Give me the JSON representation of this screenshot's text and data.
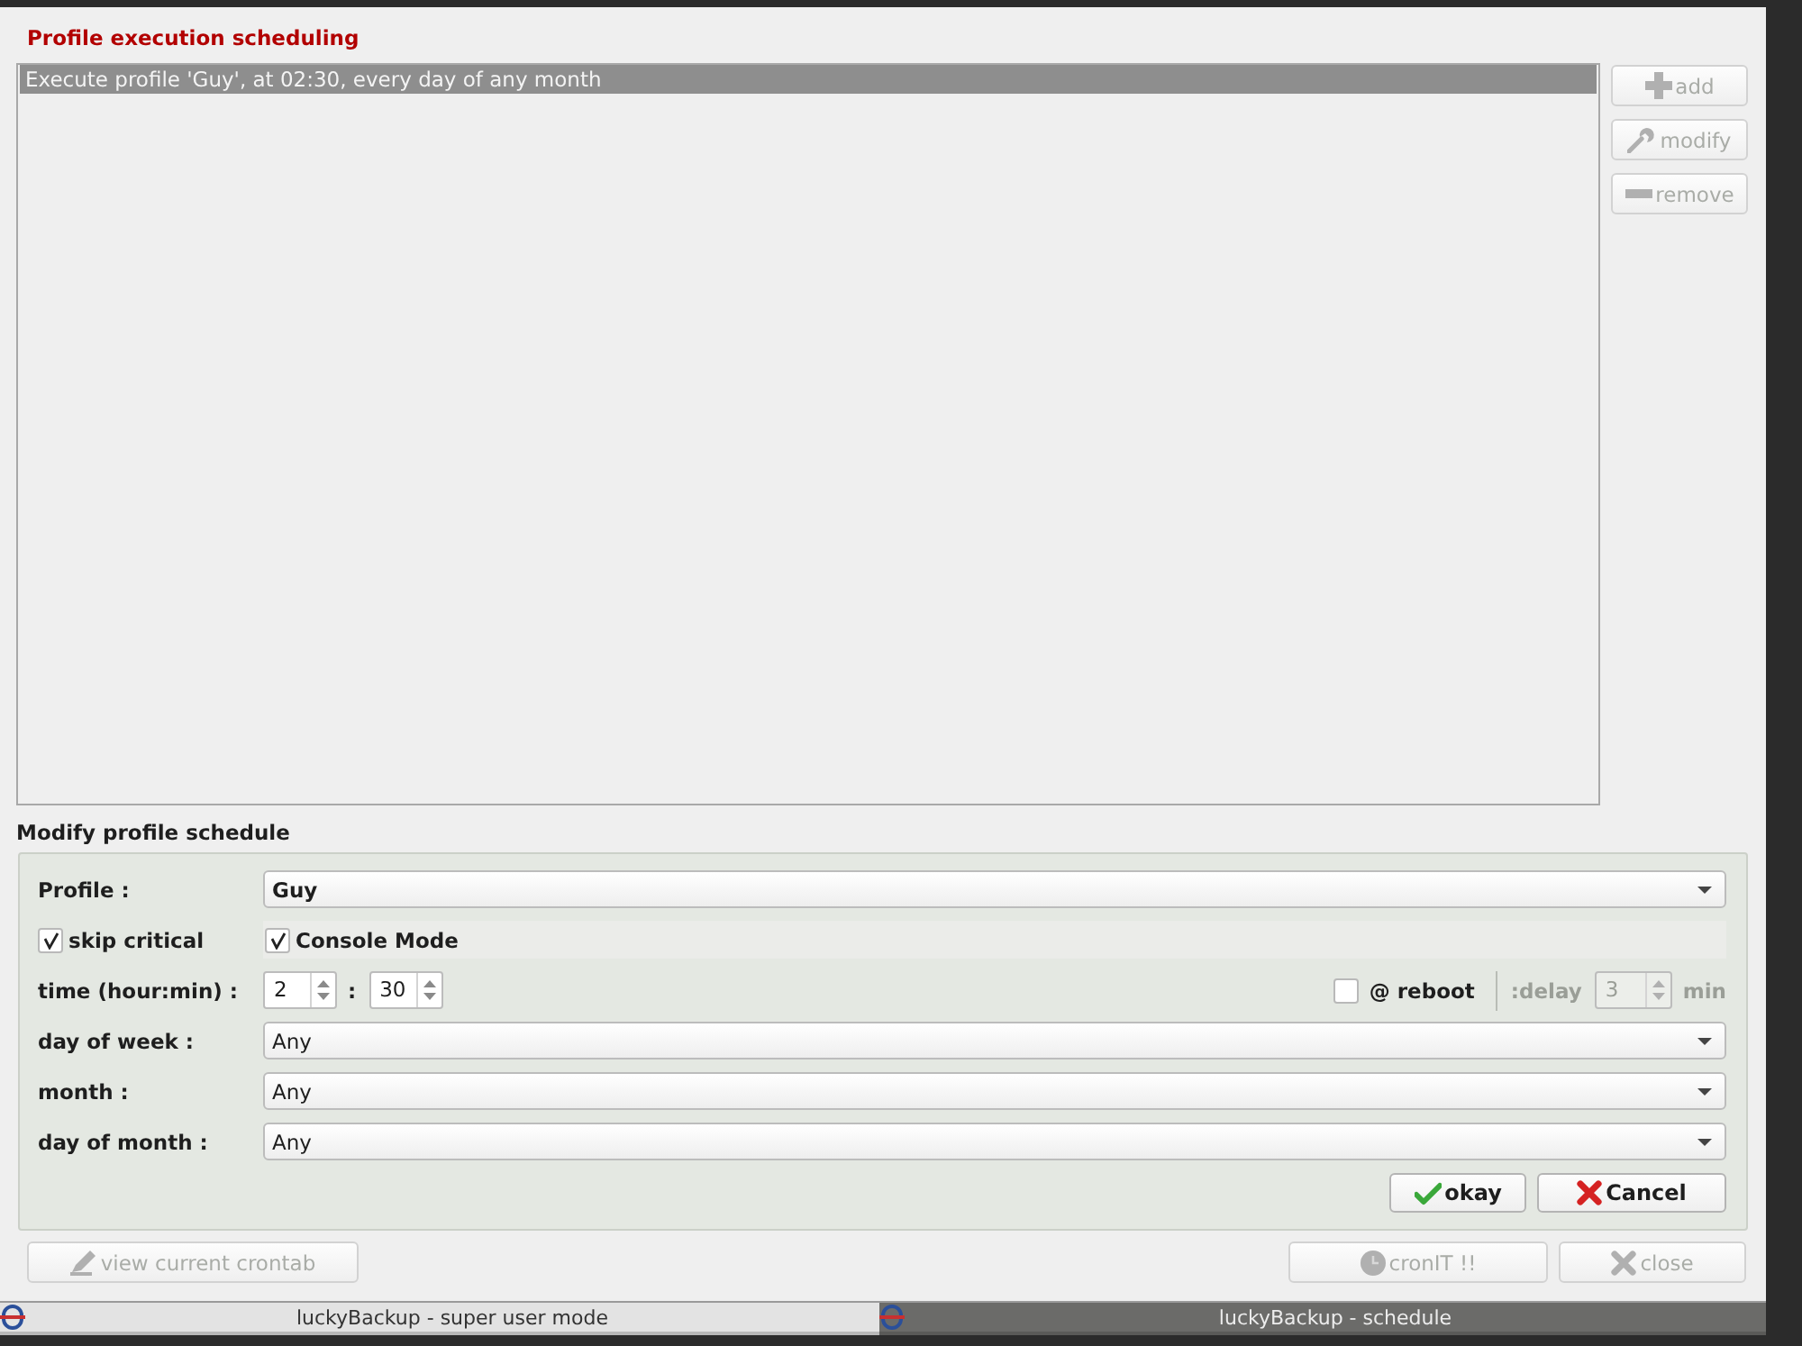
{
  "window": {
    "title": "Profile execution scheduling"
  },
  "schedule_list": {
    "items": [
      {
        "text": "Execute profile 'Guy', at 02:30, every day of any month",
        "selected": true
      }
    ]
  },
  "list_buttons": [
    {
      "label": "add",
      "disabled": true
    },
    {
      "label": "modify",
      "disabled": true
    },
    {
      "label": "remove",
      "disabled": true
    }
  ],
  "modify_schedule": {
    "title": "Modify profile schedule",
    "profile": {
      "label": "Profile :",
      "value": "Guy"
    },
    "skip_critical": {
      "label": "skip critical",
      "checked": true
    },
    "console_mode": {
      "label": "Console Mode",
      "checked": true
    },
    "time": {
      "label": "time (hour:min) :",
      "hour": "2",
      "separator": ":",
      "minute": "30"
    },
    "reboot": {
      "label": "@ reboot",
      "checked": false
    },
    "delay": {
      "label": ":delay",
      "value": "3",
      "unit": "min",
      "disabled": true
    },
    "day_of_week": {
      "label": "day of week :",
      "value": "Any"
    },
    "month": {
      "label": "month :",
      "value": "Any"
    },
    "day_of_month": {
      "label": "day of month :",
      "value": "Any"
    },
    "buttons": [
      {
        "label": "okay"
      },
      {
        "label": "Cancel"
      }
    ]
  },
  "footer_buttons": [
    {
      "label": "view current crontab",
      "disabled": true
    },
    {
      "label": "cronIT !!",
      "disabled": true
    },
    {
      "label": "close",
      "disabled": true
    }
  ],
  "taskbar": [
    {
      "title": "luckyBackup - super user mode",
      "selected": false
    },
    {
      "title": "luckyBackup - schedule",
      "selected": true
    }
  ]
}
